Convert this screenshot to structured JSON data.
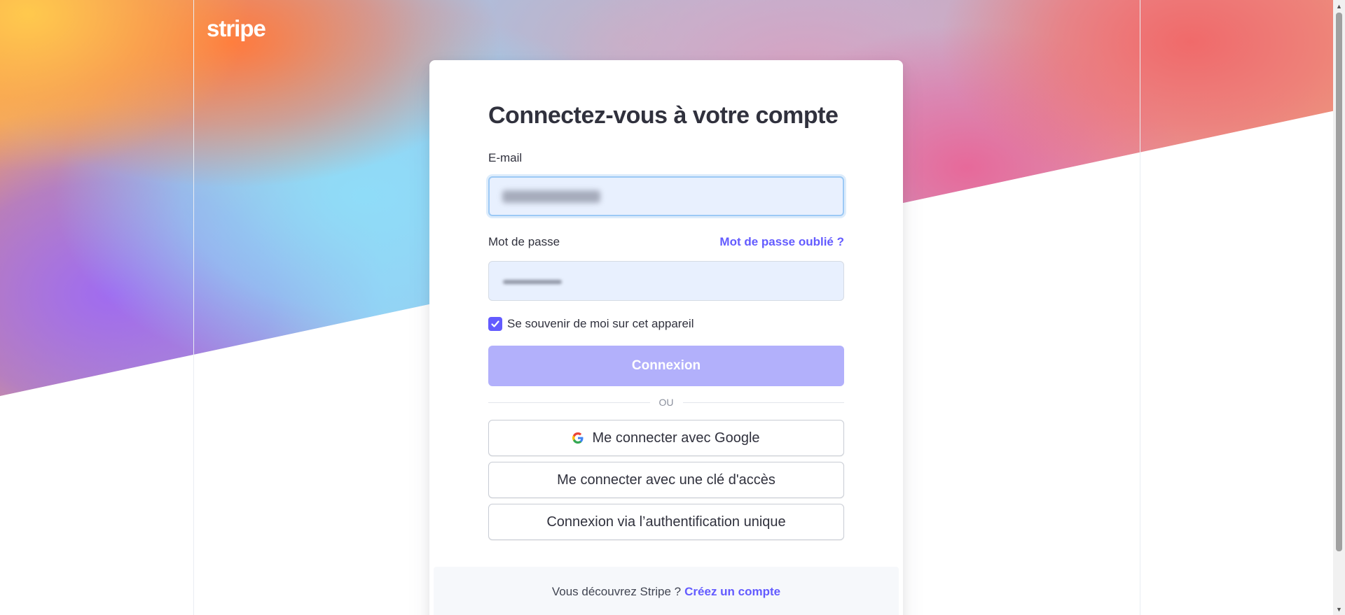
{
  "brand": {
    "logo_text": "stripe"
  },
  "login": {
    "title": "Connectez-vous à votre compte",
    "email_label": "E-mail",
    "password_label": "Mot de passe",
    "forgot_link": "Mot de passe oublié ?",
    "remember_label": "Se souvenir de moi sur cet appareil",
    "remember_checked": true,
    "submit_label": "Connexion",
    "or_label": "OU",
    "google_label": "Me connecter avec Google",
    "passkey_label": "Me connecter avec une clé d'accès",
    "sso_label": "Connexion via l’authentification unique"
  },
  "footer": {
    "prompt": "Vous découvrez Stripe ?",
    "signup_link": "Créez un compte"
  },
  "colors": {
    "accent": "#635bff",
    "button_disabled": "#b2b0fb",
    "input_fill": "#e8f0fe",
    "text": "#30313d"
  },
  "icons": {
    "google": "google-g-icon",
    "check": "checkmark-icon"
  }
}
